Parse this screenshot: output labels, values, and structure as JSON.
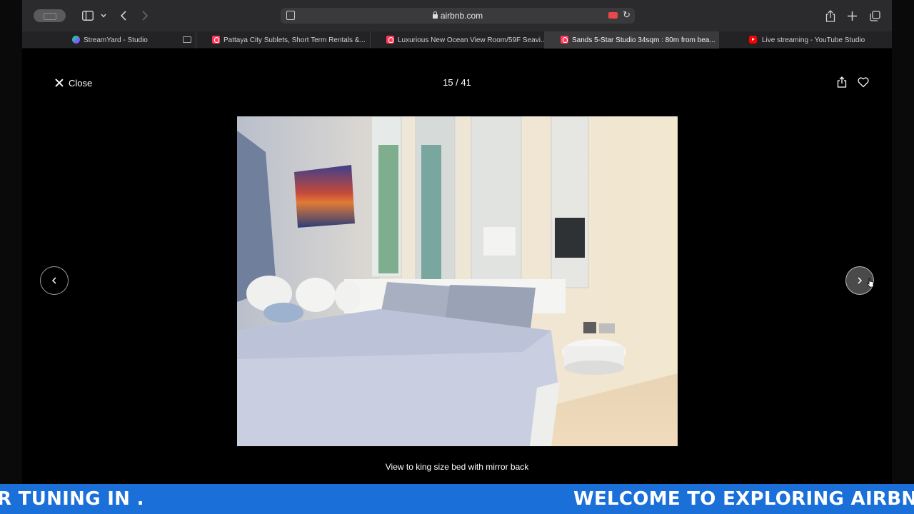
{
  "browser": {
    "url": "airbnb.com",
    "tabs": [
      {
        "title": "StreamYard - Studio",
        "icon": "streamyard-icon"
      },
      {
        "title": "Pattaya City Sublets, Short Term Rentals &...",
        "icon": "airbnb-icon"
      },
      {
        "title": "Luxurious New Ocean View Room/59F Seavi...",
        "icon": "airbnb-icon"
      },
      {
        "title": "Sands 5-Star Studio 34sqm : 80m from bea...",
        "icon": "airbnb-icon"
      },
      {
        "title": "Live streaming - YouTube Studio",
        "icon": "youtube-icon"
      }
    ]
  },
  "lightbox": {
    "close_label": "Close",
    "counter": "15 / 41",
    "caption": "View to king size bed with mirror back"
  },
  "ticker": {
    "left_text": "R TUNING IN .",
    "right_text": "WELCOME TO EXPLORING AIRBNBS F"
  },
  "colors": {
    "ticker_bg": "#1a6fd8",
    "airbnb": "#ff385c"
  }
}
